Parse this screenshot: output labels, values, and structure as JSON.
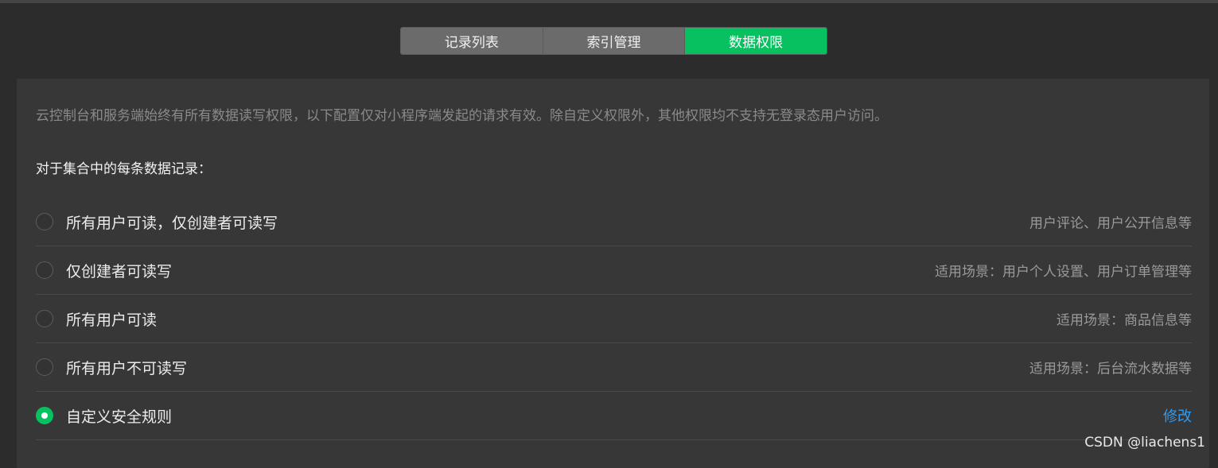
{
  "tabs": [
    {
      "label": "记录列表",
      "active": false
    },
    {
      "label": "索引管理",
      "active": false
    },
    {
      "label": "数据权限",
      "active": true
    }
  ],
  "notice": "云控制台和服务端始终有所有数据读写权限，以下配置仅对小程序端发起的请求有效。除自定义权限外，其他权限均不支持无登录态用户访问。",
  "section_title": "对于集合中的每条数据记录：",
  "options": [
    {
      "label": "所有用户可读，仅创建者可读写",
      "hint": "用户评论、用户公开信息等",
      "checked": false
    },
    {
      "label": "仅创建者可读写",
      "hint": "适用场景：用户个人设置、用户订单管理等",
      "checked": false
    },
    {
      "label": "所有用户可读",
      "hint": "适用场景：商品信息等",
      "checked": false
    },
    {
      "label": "所有用户不可读写",
      "hint": "适用场景：后台流水数据等",
      "checked": false
    },
    {
      "label": "自定义安全规则",
      "link": "修改",
      "checked": true
    }
  ],
  "watermark": "CSDN @liachens1",
  "colors": {
    "accent": "#07c160",
    "link": "#2f9bf1",
    "panel": "#373737",
    "background": "#2c2c2c"
  }
}
